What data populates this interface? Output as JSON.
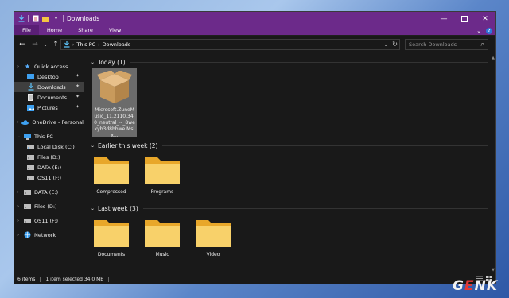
{
  "window": {
    "title": "Downloads",
    "accent": "#6c2a8a"
  },
  "ribbon": {
    "tabs": [
      "File",
      "Home",
      "Share",
      "View"
    ]
  },
  "nav": {
    "back": "←",
    "forward": "→",
    "up": "↑",
    "breadcrumb": [
      "This PC",
      "Downloads"
    ],
    "search_placeholder": "Search Downloads"
  },
  "sidebar": {
    "quick_access": "Quick access",
    "pinned": [
      {
        "label": "Desktop",
        "icon": "desktop-icon"
      },
      {
        "label": "Downloads",
        "icon": "downloads-icon"
      },
      {
        "label": "Documents",
        "icon": "documents-icon"
      },
      {
        "label": "Pictures",
        "icon": "pictures-icon"
      }
    ],
    "onedrive": "OneDrive - Personal",
    "this_pc": "This PC",
    "drives": [
      "Local Disk (C:)",
      "Files (D:)",
      "DATA (E:)",
      "OS11 (F:)"
    ],
    "extra": [
      "DATA (E:)",
      "Files (D:)",
      "OS11 (F:)"
    ],
    "network": "Network"
  },
  "groups": [
    {
      "header": "Today (1)",
      "items": [
        "Microsoft.ZuneMusic_11.2110.34.0_neutral_~_8wekyb3d8bbwe.Msix..."
      ]
    },
    {
      "header": "Earlier this week (2)",
      "items": [
        "Compressed",
        "Programs"
      ]
    },
    {
      "header": "Last week (3)",
      "items": [
        "Documents",
        "Music",
        "Video"
      ]
    }
  ],
  "status": {
    "count": "6 items",
    "selected": "1 item selected  34.0 MB"
  },
  "watermark": {
    "pre": "G",
    "mid": "E",
    "post": "NK"
  }
}
